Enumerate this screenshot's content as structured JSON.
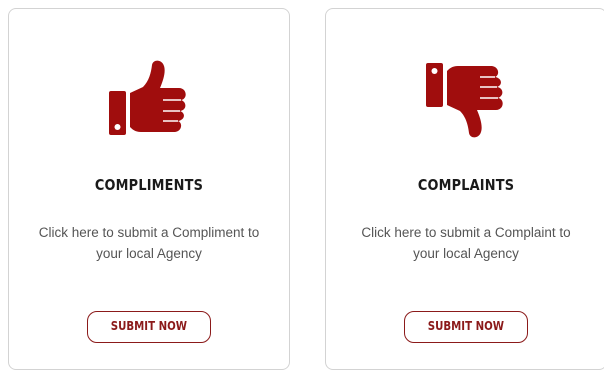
{
  "colors": {
    "accent": "#a00d0d",
    "button_border": "#8b1a1a",
    "title": "#1a1a1a",
    "text": "#555555",
    "card_border": "#d3d3d3"
  },
  "cards": [
    {
      "icon": "thumbs-up-icon",
      "title": "COMPLIMENTS",
      "description": "Click here to submit a Compliment to your local Agency",
      "button_label": "SUBMIT NOW"
    },
    {
      "icon": "thumbs-down-icon",
      "title": "COMPLAINTS",
      "description": "Click here to submit a Complaint to your local Agency",
      "button_label": "SUBMIT NOW"
    }
  ]
}
